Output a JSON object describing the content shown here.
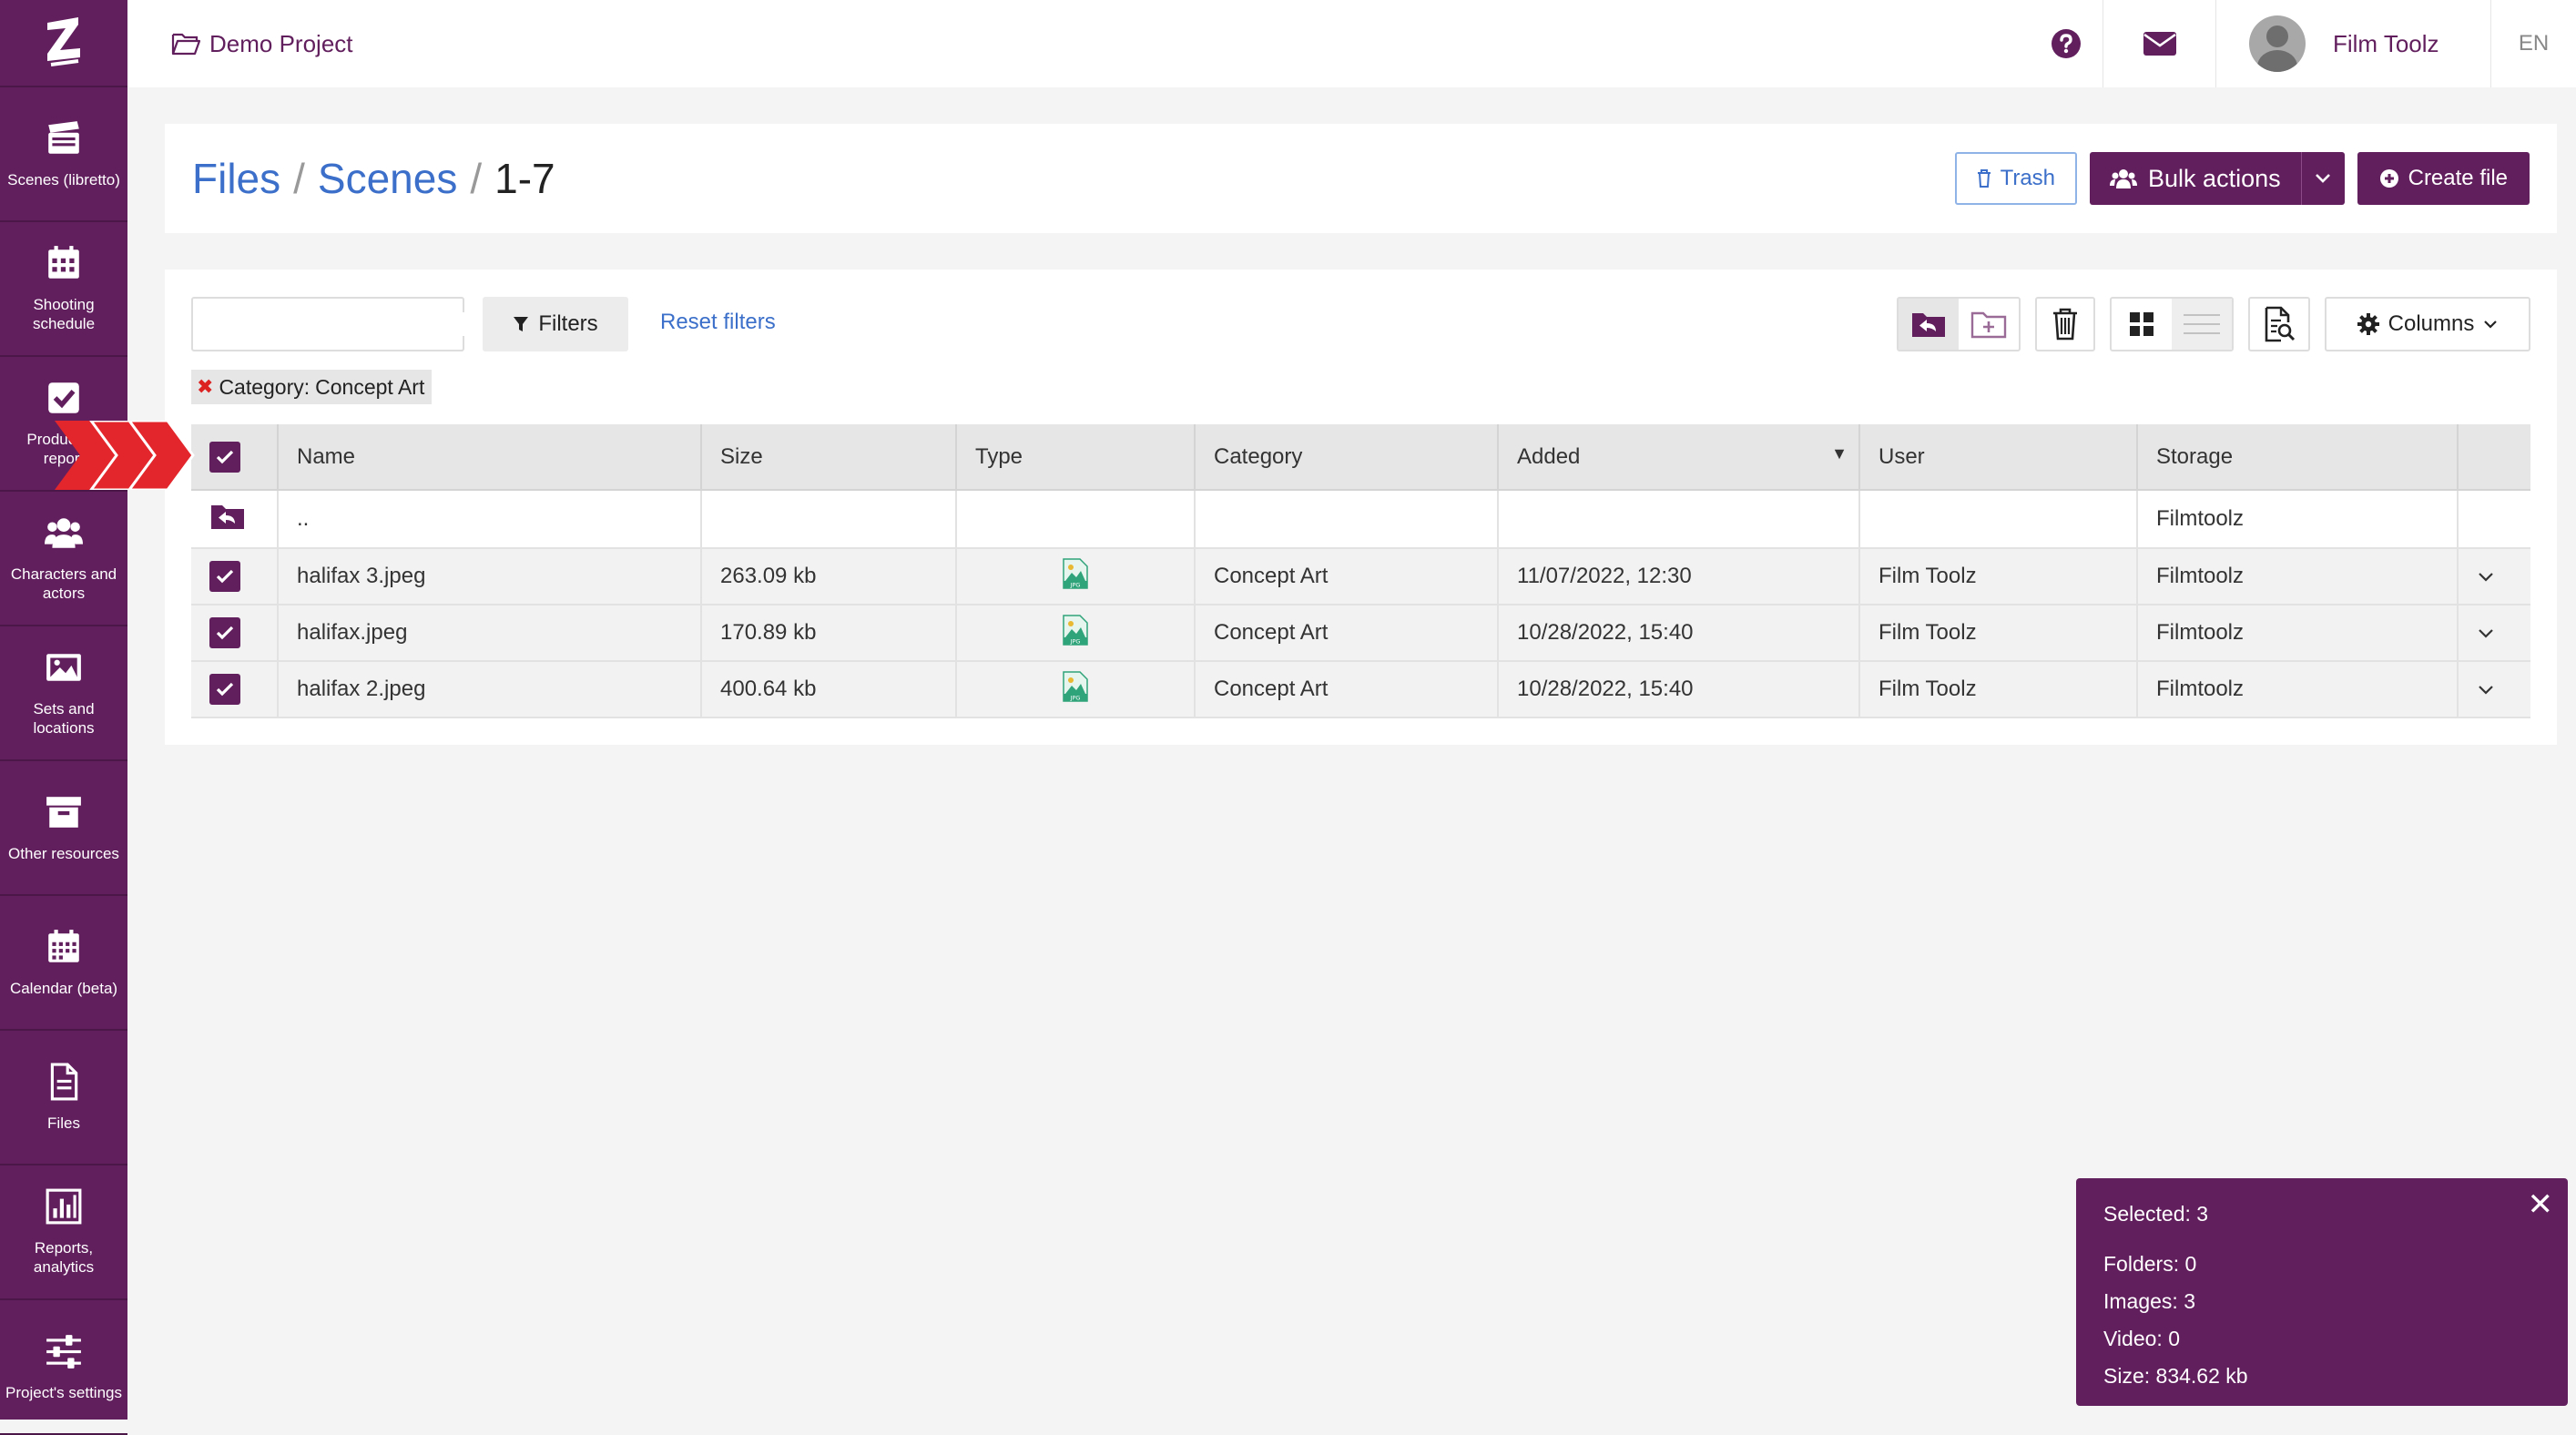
{
  "sidebar": {
    "items": [
      {
        "label": "Scenes (libretto)"
      },
      {
        "label": "Shooting schedule"
      },
      {
        "label": "Production report"
      },
      {
        "label": "Characters and actors"
      },
      {
        "label": "Sets and locations"
      },
      {
        "label": "Other resources"
      },
      {
        "label": "Calendar (beta)"
      },
      {
        "label": "Files"
      },
      {
        "label": "Reports, analytics"
      },
      {
        "label": "Project's settings"
      }
    ]
  },
  "topbar": {
    "project_name": "Demo Project",
    "user_name": "Film Toolz",
    "language": "EN"
  },
  "header": {
    "breadcrumb": [
      "Files",
      "Scenes",
      "1-7"
    ],
    "trash_label": "Trash",
    "bulk_label": "Bulk actions",
    "create_label": "Create file"
  },
  "toolbar": {
    "search_placeholder": "",
    "filters_label": "Filters",
    "reset_label": "Reset filters",
    "columns_label": "Columns"
  },
  "active_filter": {
    "key": "Category:",
    "value": "Concept Art"
  },
  "table": {
    "columns": [
      "Name",
      "Size",
      "Type",
      "Category",
      "Added",
      "User",
      "Storage"
    ],
    "up_row": {
      "name": "..",
      "storage": "Filmtoolz"
    },
    "rows": [
      {
        "name": "halifax 3.jpeg",
        "size": "263.09 kb",
        "type": "JPG",
        "category": "Concept Art",
        "added": "11/07/2022, 12:30",
        "user": "Film Toolz",
        "storage": "Filmtoolz"
      },
      {
        "name": "halifax.jpeg",
        "size": "170.89 kb",
        "type": "JPG",
        "category": "Concept Art",
        "added": "10/28/2022, 15:40",
        "user": "Film Toolz",
        "storage": "Filmtoolz"
      },
      {
        "name": "halifax 2.jpeg",
        "size": "400.64 kb",
        "type": "JPG",
        "category": "Concept Art",
        "added": "10/28/2022, 15:40",
        "user": "Film Toolz",
        "storage": "Filmtoolz"
      }
    ]
  },
  "selection": {
    "selected": "Selected: 3",
    "folders": "Folders: 0",
    "images": "Images: 3",
    "video": "Video: 0",
    "size": "Size: 834.62 kb"
  },
  "colors": {
    "brand": "#621f5e",
    "link": "#3b6fc9",
    "marker": "#e3262b"
  }
}
